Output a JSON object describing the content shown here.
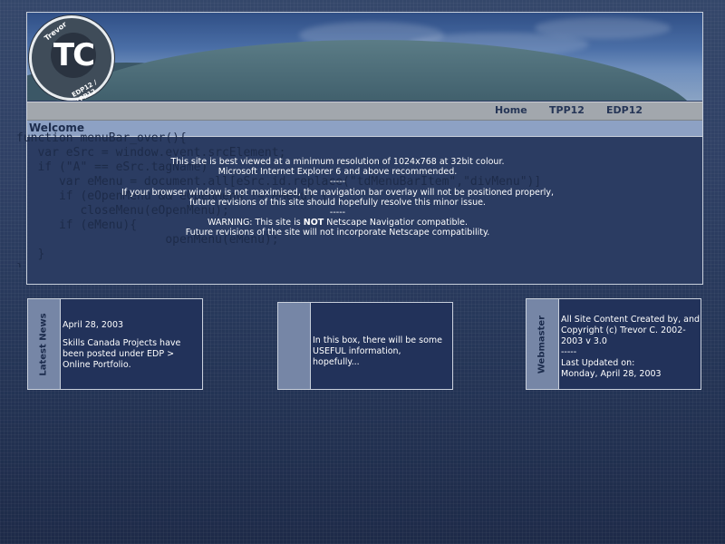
{
  "header": {
    "logo": {
      "initials": "TC",
      "top_text": "Trevor",
      "bottom_text": "EDP12 / TPP12"
    }
  },
  "nav": {
    "items": [
      {
        "label": "Home"
      },
      {
        "label": "TPP12"
      },
      {
        "label": "EDP12"
      }
    ]
  },
  "welcome": {
    "title": "Welcome",
    "code_background": "function menuBar_over(){\n   var eSrc = window.event.srcElement;\n   if (\"A\" == eSrc.tagName)\n      var eMenu = document.all[eSrc.id.replace(\"tdMenuBarItem\",\"divMenu\")]\n      if (eOpenMenu && eOpenMenu != eMenu) {\n         closeMenu(eOpenMenu);\n      if (eMenu){\n                     openMenu(eMenu);\n   }\n}",
    "notice": {
      "line1": "This site is best viewed at a minimum resolution of 1024x768 at 32bit colour.",
      "line2": "Microsoft Internet Explorer 6 and above recommended.",
      "sep1": "-----",
      "line3": "If your browser window is not maximised, the navigation bar overlay will not be positioned properly,",
      "line4": "future revisions of this site should hopefully resolve this minor issue.",
      "sep2": "-----",
      "warning_pre": "WARNING: This site is ",
      "warning_bold": "NOT",
      "warning_post": " Netscape Navigatior compatible.",
      "line6": "Future revisions of the site will not incorporate Netscape compatibility."
    }
  },
  "boxes": {
    "news": {
      "label": "Latest News",
      "date": "April 28, 2003",
      "text": "Skills Canada Projects have been posted under EDP > Online Portfolio."
    },
    "info": {
      "label": "",
      "text": "In this box, there will be some USEFUL information, hopefully..."
    },
    "webmaster": {
      "label": "Webmaster",
      "text": "All Site Content Created by, and Copyright (c) Trevor C. 2002-2003 v 3.0",
      "sep": "-----",
      "updated_label": "Last Updated on:",
      "updated_date": "Monday, April 28, 2003"
    }
  },
  "colors": {
    "background": "#2f4065",
    "panel": "#2b3c62",
    "navbar": "#a2a7ad",
    "welcome_bar": "#8da1c4",
    "accent_text": "#253556"
  }
}
